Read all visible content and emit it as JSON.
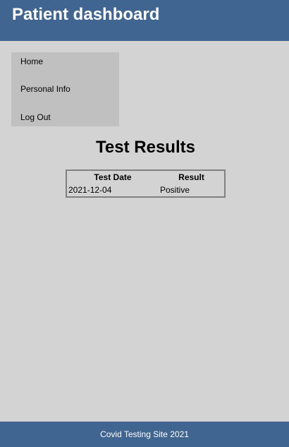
{
  "header": {
    "title": "Patient dashboard"
  },
  "sidebar": {
    "items": [
      {
        "label": "Home"
      },
      {
        "label": "Personal Info"
      },
      {
        "label": "Log Out"
      }
    ]
  },
  "main": {
    "title": "Test Results",
    "table": {
      "columns": [
        "Test Date",
        "Result"
      ],
      "rows": [
        [
          "2021-12-04",
          "Positive"
        ]
      ]
    }
  },
  "footer": {
    "text": "Covid Testing Site 2021"
  },
  "colors": {
    "header_bg": "#406591",
    "page_bg": "#d3d3d3",
    "sidebar_bg": "#c0c0c0",
    "table_border": "#808080"
  }
}
